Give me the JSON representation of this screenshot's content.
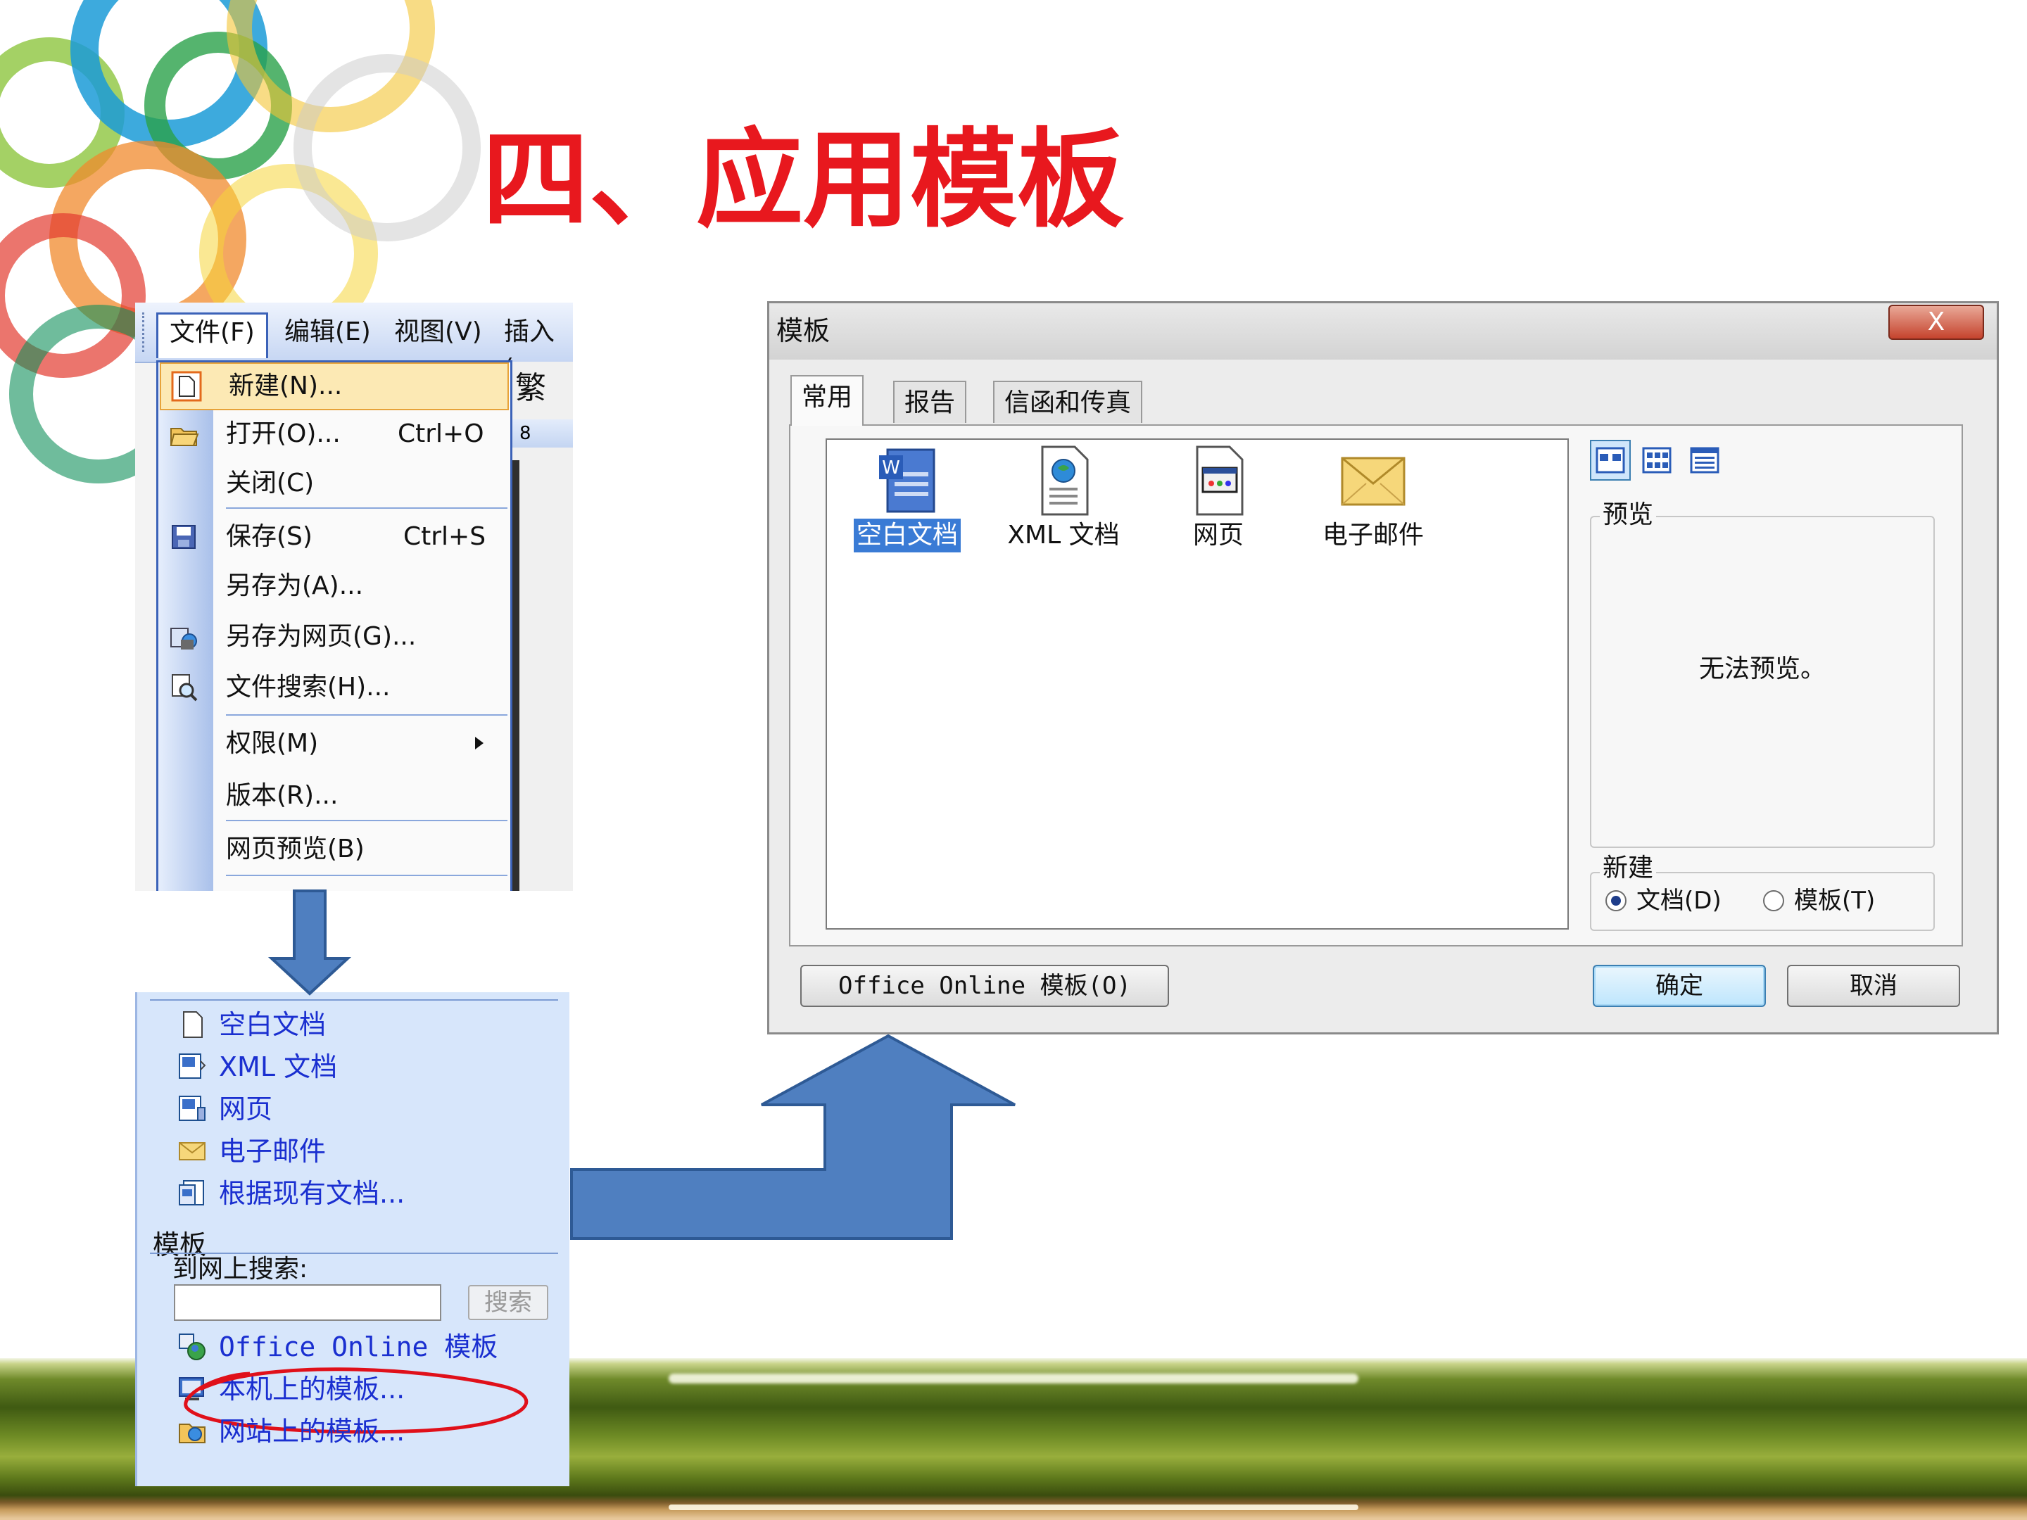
{
  "slide": {
    "title": "四、应用模板"
  },
  "menu": {
    "bar": [
      "文件(F)",
      "编辑(E)",
      "视图(V)",
      "插入("
    ],
    "toolbar_glyph": "繁",
    "toolbar_value": "8",
    "items": [
      {
        "label": "新建(N)...",
        "accel": ""
      },
      {
        "label": "打开(O)...",
        "accel": "Ctrl+O"
      },
      {
        "label": "关闭(C)",
        "accel": ""
      },
      {
        "label": "保存(S)",
        "accel": "Ctrl+S"
      },
      {
        "label": "另存为(A)...",
        "accel": ""
      },
      {
        "label": "另存为网页(G)...",
        "accel": ""
      },
      {
        "label": "文件搜索(H)...",
        "accel": ""
      },
      {
        "label": "权限(M)",
        "accel": ""
      },
      {
        "label": "版本(R)...",
        "accel": ""
      },
      {
        "label": "网页预览(B)",
        "accel": ""
      }
    ]
  },
  "task_pane": {
    "new_items": [
      "空白文档",
      "XML 文档",
      "网页",
      "电子邮件",
      "根据现有文档..."
    ],
    "templates_heading": "模板",
    "search_label": "到网上搜索:",
    "search_value": "",
    "search_button": "搜索",
    "template_links": [
      "Office Online 模板",
      "本机上的模板...",
      "网站上的模板..."
    ]
  },
  "dialog": {
    "title": "模板",
    "close_label": "X",
    "tabs": [
      "常用",
      "报告",
      "信函和传真"
    ],
    "templates": [
      "空白文档",
      "XML 文档",
      "网页",
      "电子邮件"
    ],
    "selected_template": "空白文档",
    "preview_label": "预览",
    "preview_message": "无法预览。",
    "new_label": "新建",
    "radio_document": "文档(D)",
    "radio_template": "模板(T)",
    "selected_radio": "文档(D)",
    "online_button": "Office Online 模板(O)",
    "ok_button": "确定",
    "cancel_button": "取消"
  },
  "colors": {
    "title_red": "#e8181e",
    "arrow_blue": "#4f7fc0",
    "link_blue": "#1a2fd0",
    "selection_blue": "#3a7bd5",
    "highlight_circle": "#e0101a"
  }
}
